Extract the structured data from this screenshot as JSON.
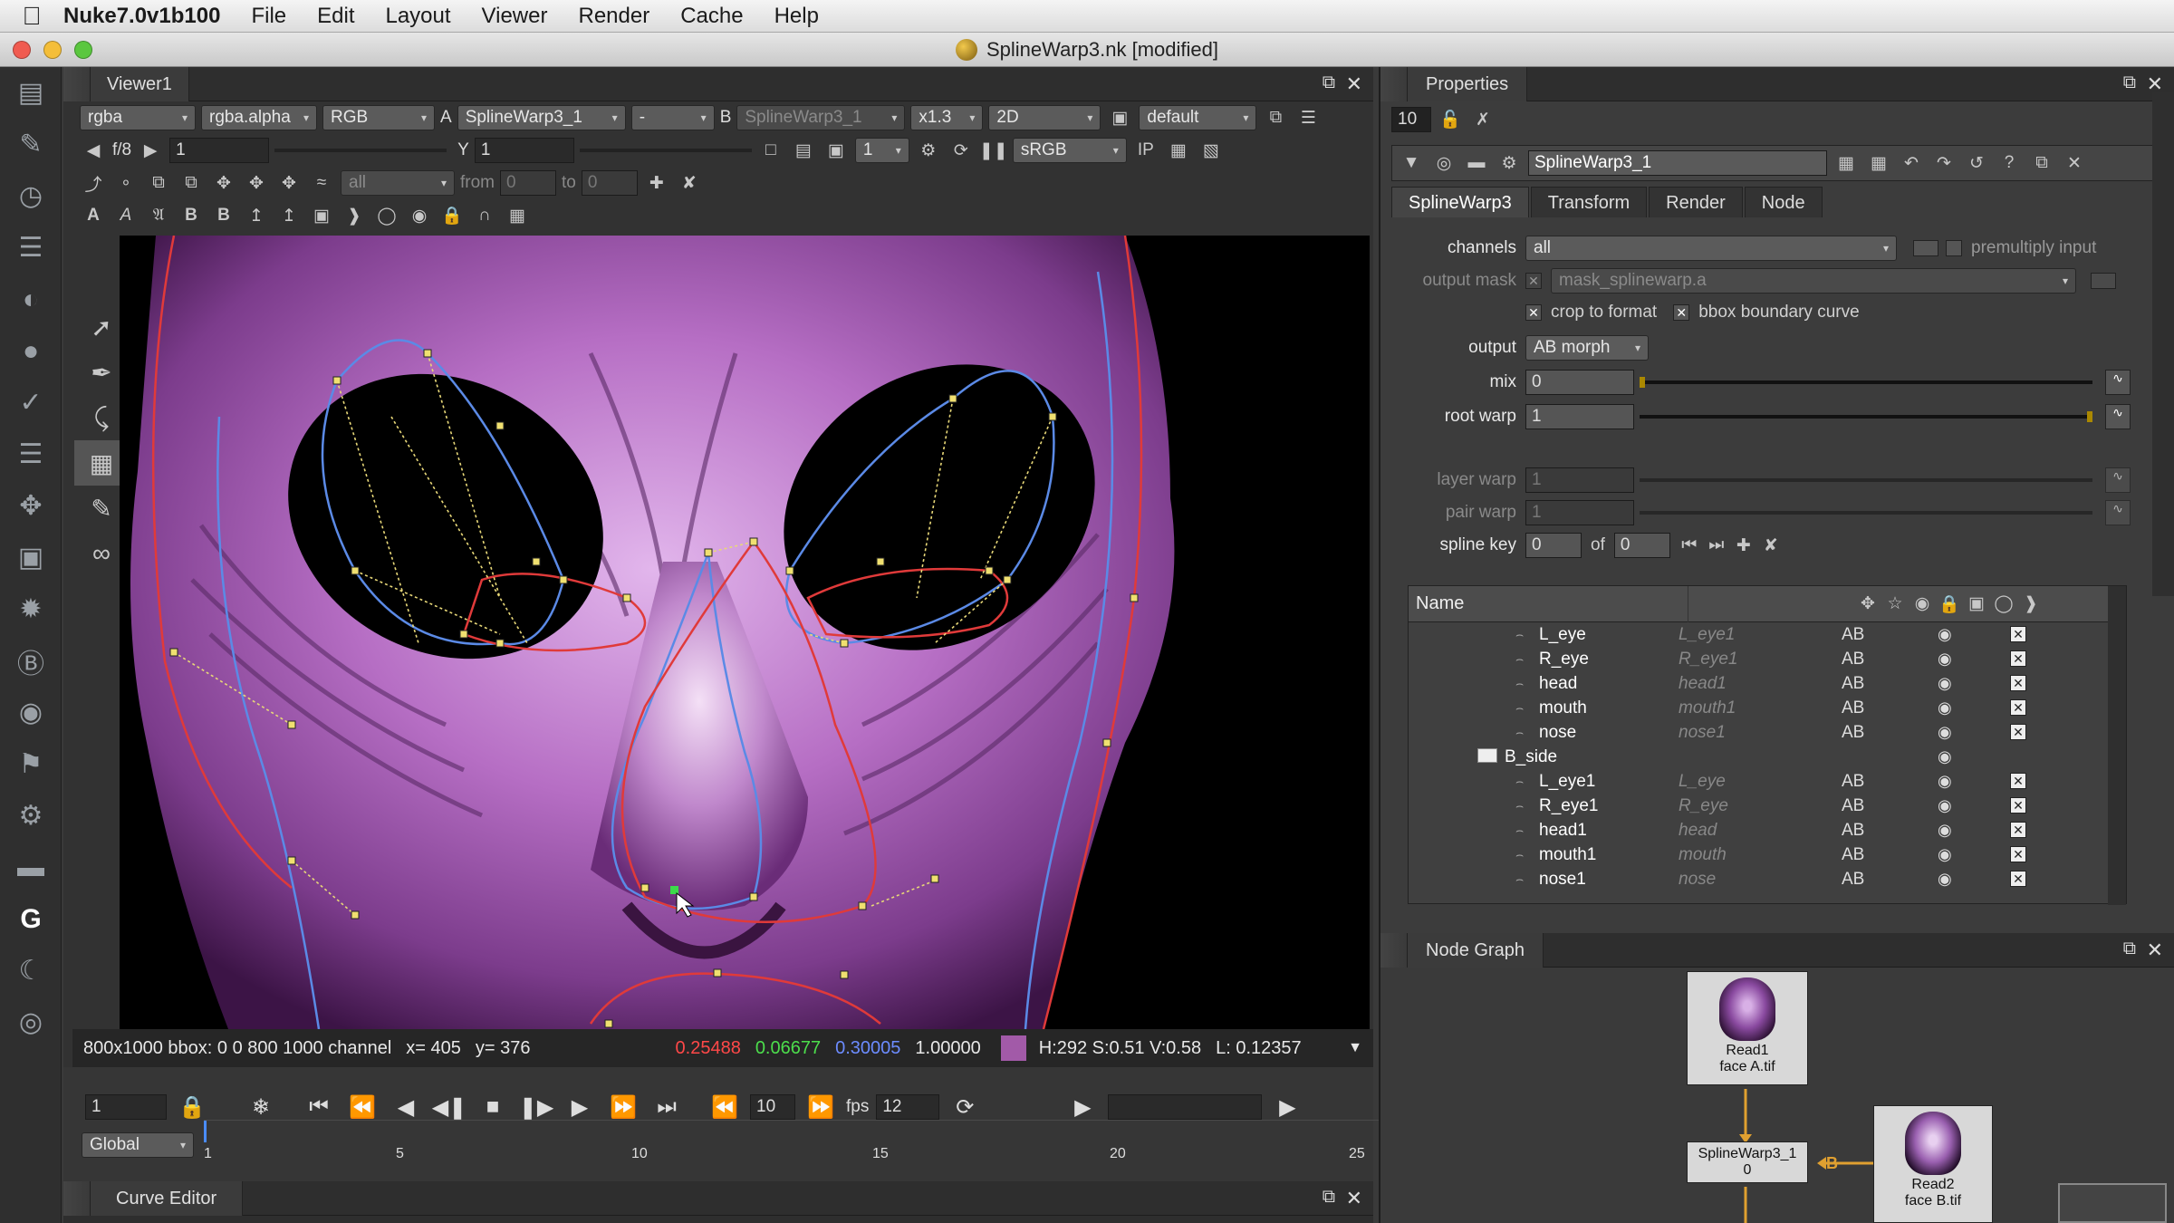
{
  "menubar": {
    "app_name": "Nuke7.0v1b100",
    "items": [
      "File",
      "Edit",
      "Layout",
      "Viewer",
      "Render",
      "Cache",
      "Help"
    ]
  },
  "window": {
    "title": "SplineWarp3.nk [modified]"
  },
  "viewer": {
    "tab": "Viewer1",
    "row1": {
      "channels": "rgba",
      "alpha": "rgba.alpha",
      "display": "RGB",
      "a_label": "A",
      "a_input": "SplineWarp3_1",
      "op": "-",
      "b_label": "B",
      "b_input": "SplineWarp3_1",
      "zoom": "x1.3",
      "mode": "2D",
      "lut_name": "default"
    },
    "row2": {
      "fstop": "f/8",
      "gain": "1",
      "y_label": "Y",
      "gamma": "1",
      "proxy": "1",
      "colorspace": "sRGB",
      "ip": "IP"
    },
    "row3": {
      "channel": "all",
      "from_label": "from",
      "from_val": "0",
      "to_label": "to",
      "to_val": "0"
    },
    "info": {
      "format": "800x1000 bbox: 0 0 800 1000 channel",
      "x_label": "x= 405",
      "y_label": "y= 376",
      "r": "0.25488",
      "g": "0.06677",
      "b": "0.30005",
      "a": "1.00000",
      "hsv": "H:292 S:0.51 V:0.58",
      "lum": "L: 0.12357"
    }
  },
  "timeline": {
    "frame": "1",
    "step": "10",
    "fps_label": "fps",
    "fps": "12",
    "range_mode": "Global",
    "ticks": [
      "1",
      "5",
      "10",
      "15",
      "20",
      "25"
    ]
  },
  "curve_editor": {
    "tab": "Curve Editor"
  },
  "properties": {
    "tab": "Properties",
    "max_panels": "10",
    "node_name": "SplineWarp3_1",
    "tabs": [
      "SplineWarp3",
      "Transform",
      "Render",
      "Node"
    ],
    "channels_label": "channels",
    "channels_val": "all",
    "premult_label": "premultiply input",
    "outmask_label": "output mask",
    "outmask_val": "mask_splinewarp.a",
    "crop_label": "crop to format",
    "bbox_label": "bbox boundary curve",
    "output_label": "output",
    "output_val": "AB morph",
    "mix_label": "mix",
    "mix_val": "0",
    "mix_level": 0,
    "rootwarp_label": "root warp",
    "rootwarp_val": "1",
    "rootwarp_level": 1,
    "layerwarp_label": "layer warp",
    "layerwarp_val": "1",
    "pairwarp_label": "pair warp",
    "pairwarp_val": "1",
    "splinekey_label": "spline key",
    "splinekey_val": "0",
    "of_label": "of",
    "of_val": "0",
    "list_header": "Name",
    "rows": [
      {
        "name": "L_eye",
        "pair": "L_eye1",
        "ab": "AB"
      },
      {
        "name": "R_eye",
        "pair": "R_eye1",
        "ab": "AB"
      },
      {
        "name": "head",
        "pair": "head1",
        "ab": "AB"
      },
      {
        "name": "mouth",
        "pair": "mouth1",
        "ab": "AB"
      },
      {
        "name": "nose",
        "pair": "nose1",
        "ab": "AB"
      },
      {
        "name": "B_side",
        "pair": "",
        "ab": ""
      },
      {
        "name": "L_eye1",
        "pair": "L_eye",
        "ab": "AB"
      },
      {
        "name": "R_eye1",
        "pair": "R_eye",
        "ab": "AB"
      },
      {
        "name": "head1",
        "pair": "head",
        "ab": "AB"
      },
      {
        "name": "mouth1",
        "pair": "mouth",
        "ab": "AB"
      },
      {
        "name": "nose1",
        "pair": "nose",
        "ab": "AB"
      }
    ]
  },
  "node_graph": {
    "tab": "Node Graph",
    "read1_line1": "Read1",
    "read1_line2": "face A.tif",
    "read2_line1": "Read2",
    "read2_line2": "face B.tif",
    "sw_line1": "SplineWarp3_1",
    "sw_line2": "0",
    "b_pipe": "B"
  }
}
